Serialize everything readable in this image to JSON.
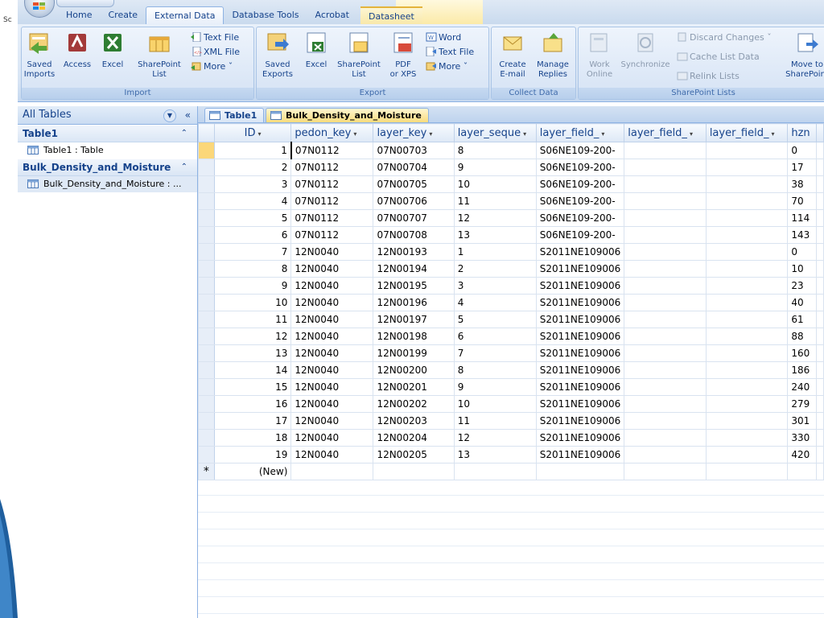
{
  "desktop": {
    "sliver": "Sc"
  },
  "tabs": [
    "Home",
    "Create",
    "External Data",
    "Database Tools",
    "Acrobat",
    "Datasheet"
  ],
  "ribbon": {
    "import": {
      "label": "Import",
      "saved_imports": [
        "Saved",
        "Imports"
      ],
      "access": "Access",
      "excel": "Excel",
      "sharepoint_list": [
        "SharePoint",
        "List"
      ],
      "text_file": "Text File",
      "xml_file": "XML File",
      "more": "More ˇ"
    },
    "export": {
      "label": "Export",
      "saved_exports": [
        "Saved",
        "Exports"
      ],
      "excel": "Excel",
      "sharepoint_list": [
        "SharePoint",
        "List"
      ],
      "pdf_xps": [
        "PDF",
        "or XPS"
      ],
      "word": "Word",
      "text_file": "Text File",
      "more": "More ˇ"
    },
    "collect": {
      "label": "Collect Data",
      "create_email": [
        "Create",
        "E-mail"
      ],
      "manage_replies": [
        "Manage",
        "Replies"
      ]
    },
    "sharepoint": {
      "label": "SharePoint Lists",
      "work_online": [
        "Work",
        "Online"
      ],
      "synchronize": "Synchronize",
      "discard_changes": "Discard Changes ˇ",
      "cache_list_data": "Cache List Data",
      "relink_lists": "Relink Lists",
      "move_to_sharepoint": [
        "Move to",
        "SharePoint"
      ]
    }
  },
  "nav": {
    "header": "All Tables",
    "groups": [
      {
        "name": "Table1",
        "items": [
          "Table1 : Table"
        ]
      },
      {
        "name": "Bulk_Density_and_Moisture",
        "items": [
          "Bulk_Density_and_Moisture : ..."
        ]
      }
    ]
  },
  "doc_tabs": [
    "Table1",
    "Bulk_Density_and_Moisture"
  ],
  "columns": [
    "ID",
    "pedon_key",
    "layer_key",
    "layer_seque",
    "layer_field_",
    "layer_field_",
    "layer_field_",
    "hzn"
  ],
  "rows": [
    [
      "1",
      "07N0112",
      "07N00703",
      "8",
      "S06NE109-200-",
      "",
      "",
      "0"
    ],
    [
      "2",
      "07N0112",
      "07N00704",
      "9",
      "S06NE109-200-",
      "",
      "",
      "17"
    ],
    [
      "3",
      "07N0112",
      "07N00705",
      "10",
      "S06NE109-200-",
      "",
      "",
      "38"
    ],
    [
      "4",
      "07N0112",
      "07N00706",
      "11",
      "S06NE109-200-",
      "",
      "",
      "70"
    ],
    [
      "5",
      "07N0112",
      "07N00707",
      "12",
      "S06NE109-200-",
      "",
      "",
      "114"
    ],
    [
      "6",
      "07N0112",
      "07N00708",
      "13",
      "S06NE109-200-",
      "",
      "",
      "143"
    ],
    [
      "7",
      "12N0040",
      "12N00193",
      "1",
      "S2011NE109006",
      "",
      "",
      "0"
    ],
    [
      "8",
      "12N0040",
      "12N00194",
      "2",
      "S2011NE109006",
      "",
      "",
      "10"
    ],
    [
      "9",
      "12N0040",
      "12N00195",
      "3",
      "S2011NE109006",
      "",
      "",
      "23"
    ],
    [
      "10",
      "12N0040",
      "12N00196",
      "4",
      "S2011NE109006",
      "",
      "",
      "40"
    ],
    [
      "11",
      "12N0040",
      "12N00197",
      "5",
      "S2011NE109006",
      "",
      "",
      "61"
    ],
    [
      "12",
      "12N0040",
      "12N00198",
      "6",
      "S2011NE109006",
      "",
      "",
      "88"
    ],
    [
      "13",
      "12N0040",
      "12N00199",
      "7",
      "S2011NE109006",
      "",
      "",
      "160"
    ],
    [
      "14",
      "12N0040",
      "12N00200",
      "8",
      "S2011NE109006",
      "",
      "",
      "186"
    ],
    [
      "15",
      "12N0040",
      "12N00201",
      "9",
      "S2011NE109006",
      "",
      "",
      "240"
    ],
    [
      "16",
      "12N0040",
      "12N00202",
      "10",
      "S2011NE109006",
      "",
      "",
      "279"
    ],
    [
      "17",
      "12N0040",
      "12N00203",
      "11",
      "S2011NE109006",
      "",
      "",
      "301"
    ],
    [
      "18",
      "12N0040",
      "12N00204",
      "12",
      "S2011NE109006",
      "",
      "",
      "330"
    ],
    [
      "19",
      "12N0040",
      "12N00205",
      "13",
      "S2011NE109006",
      "",
      "",
      "420"
    ]
  ],
  "new_row": {
    "marker": "*",
    "label": "(New)"
  }
}
